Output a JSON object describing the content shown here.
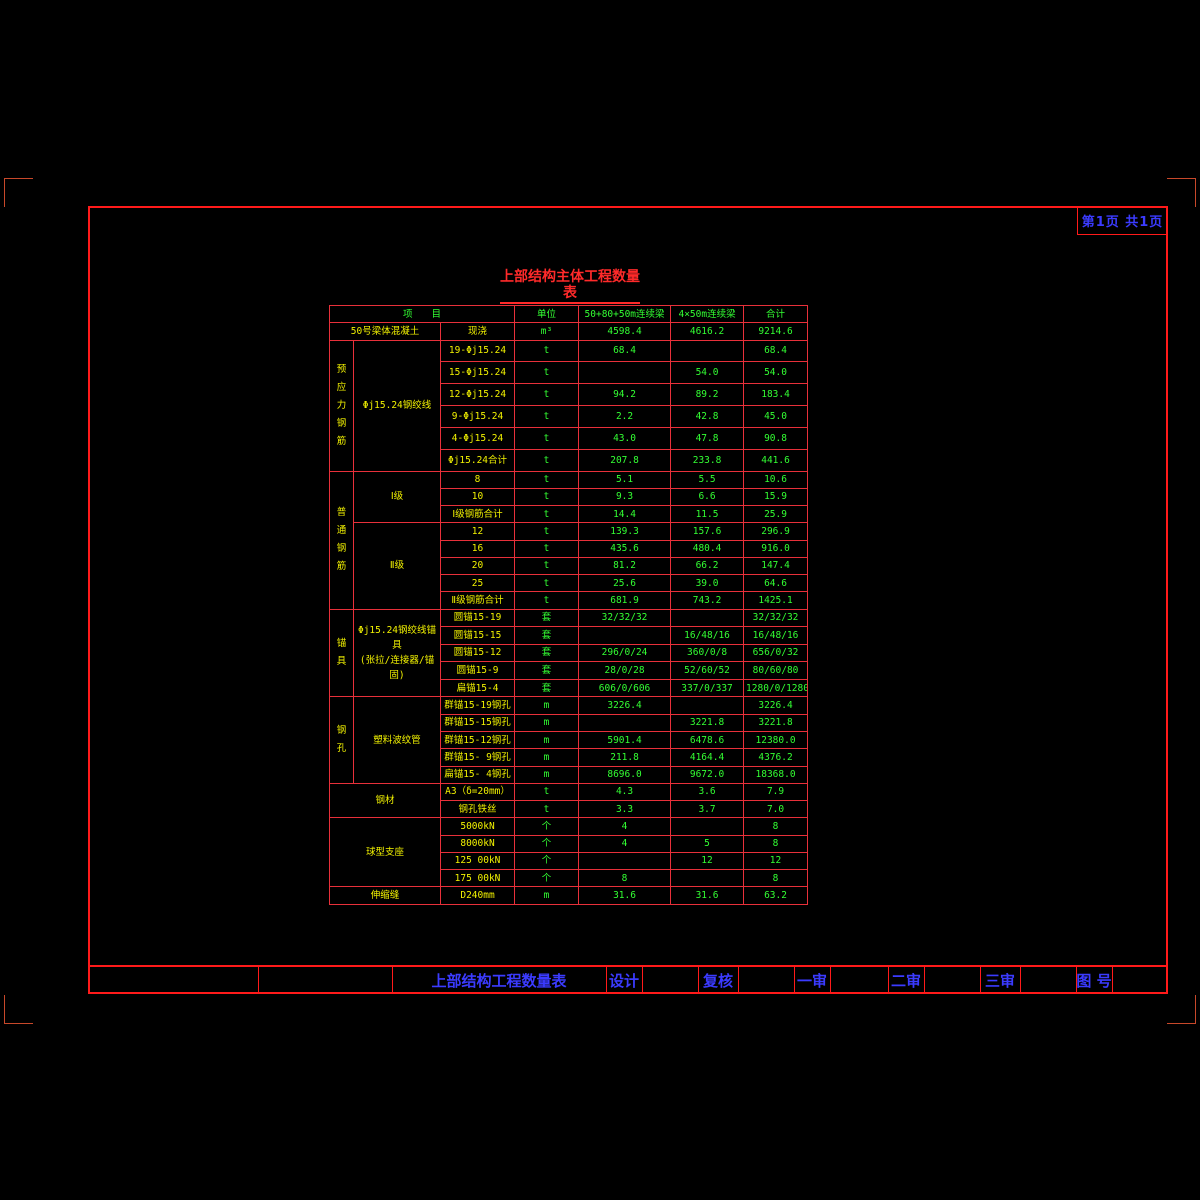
{
  "page_label": "第1页 共1页",
  "title": "上部结构主体工程数量表",
  "table": {
    "header": [
      "项　　目",
      "单位",
      "50+80+50m连续梁",
      "4×50m连续梁",
      "合计"
    ],
    "concrete": {
      "item": "50号梁体混凝土",
      "spec": "现浇",
      "unit": "m³",
      "a": "4598.4",
      "b": "4616.2",
      "total": "9214.6"
    },
    "prestress": {
      "group": "预应力钢筋",
      "sub": "Φj15.24钢绞线",
      "rows": [
        {
          "spec": "19-Φj15.24",
          "unit": "t",
          "a": "68.4",
          "b": "",
          "total": "68.4"
        },
        {
          "spec": "15-Φj15.24",
          "unit": "t",
          "a": "",
          "b": "54.0",
          "total": "54.0"
        },
        {
          "spec": "12-Φj15.24",
          "unit": "t",
          "a": "94.2",
          "b": "89.2",
          "total": "183.4"
        },
        {
          "spec": "9-Φj15.24",
          "unit": "t",
          "a": "2.2",
          "b": "42.8",
          "total": "45.0"
        },
        {
          "spec": "4-Φj15.24",
          "unit": "t",
          "a": "43.0",
          "b": "47.8",
          "total": "90.8"
        },
        {
          "spec": "Φj15.24合计",
          "unit": "t",
          "a": "207.8",
          "b": "233.8",
          "total": "441.6"
        }
      ]
    },
    "rebar": {
      "group": "普通钢筋",
      "grade1": {
        "label": "Ⅰ级",
        "rows": [
          {
            "spec": "8",
            "unit": "t",
            "a": "5.1",
            "b": "5.5",
            "total": "10.6"
          },
          {
            "spec": "10",
            "unit": "t",
            "a": "9.3",
            "b": "6.6",
            "total": "15.9"
          },
          {
            "spec": "Ⅰ级钢筋合计",
            "unit": "t",
            "a": "14.4",
            "b": "11.5",
            "total": "25.9"
          }
        ]
      },
      "grade2": {
        "label": "Ⅱ级",
        "rows": [
          {
            "spec": "12",
            "unit": "t",
            "a": "139.3",
            "b": "157.6",
            "total": "296.9"
          },
          {
            "spec": "16",
            "unit": "t",
            "a": "435.6",
            "b": "480.4",
            "total": "916.0"
          },
          {
            "spec": "20",
            "unit": "t",
            "a": "81.2",
            "b": "66.2",
            "total": "147.4"
          },
          {
            "spec": "25",
            "unit": "t",
            "a": "25.6",
            "b": "39.0",
            "total": "64.6"
          },
          {
            "spec": "Ⅱ级钢筋合计",
            "unit": "t",
            "a": "681.9",
            "b": "743.2",
            "total": "1425.1"
          }
        ]
      }
    },
    "anchor": {
      "group": "锚具",
      "sub1": "Φj15.24钢绞线锚具",
      "sub2": "(张拉/连接器/锚固)",
      "rows": [
        {
          "spec": "圆锚15-19",
          "unit": "套",
          "a": "32/32/32",
          "b": "",
          "total": "32/32/32"
        },
        {
          "spec": "圆锚15-15",
          "unit": "套",
          "a": "",
          "b": "16/48/16",
          "total": "16/48/16"
        },
        {
          "spec": "圆锚15-12",
          "unit": "套",
          "a": "296/0/24",
          "b": "360/0/8",
          "total": "656/0/32"
        },
        {
          "spec": "圆锚15-9",
          "unit": "套",
          "a": "28/0/28",
          "b": "52/60/52",
          "total": "80/60/80"
        },
        {
          "spec": "扁锚15-4",
          "unit": "套",
          "a": "606/0/606",
          "b": "337/0/337",
          "total": "1280/0/1280"
        }
      ]
    },
    "duct": {
      "group": "钢孔",
      "sub": "塑料波纹管",
      "rows": [
        {
          "spec": "群锚15-19钢孔",
          "unit": "m",
          "a": "3226.4",
          "b": "",
          "total": "3226.4"
        },
        {
          "spec": "群锚15-15钢孔",
          "unit": "m",
          "a": "",
          "b": "3221.8",
          "total": "3221.8"
        },
        {
          "spec": "群锚15-12钢孔",
          "unit": "m",
          "a": "5901.4",
          "b": "6478.6",
          "total": "12380.0"
        },
        {
          "spec": "群锚15- 9钢孔",
          "unit": "m",
          "a": "211.8",
          "b": "4164.4",
          "total": "4376.2"
        },
        {
          "spec": "扁锚15- 4钢孔",
          "unit": "m",
          "a": "8696.0",
          "b": "9672.0",
          "total": "18368.0"
        }
      ]
    },
    "steel": {
      "group": "钢材",
      "rows": [
        {
          "spec": "A3（δ=20mm）",
          "unit": "t",
          "a": "4.3",
          "b": "3.6",
          "total": "7.9"
        },
        {
          "spec": "钢孔铁丝",
          "unit": "t",
          "a": "3.3",
          "b": "3.7",
          "total": "7.0"
        }
      ]
    },
    "bearing": {
      "group": "球型支座",
      "rows": [
        {
          "spec": "5000kN",
          "unit": "个",
          "a": "4",
          "b": "",
          "total": "8"
        },
        {
          "spec": "8000kN",
          "unit": "个",
          "a": "4",
          "b": "5",
          "total": "8"
        },
        {
          "spec": "125 00kN",
          "unit": "个",
          "a": "",
          "b": "12",
          "total": "12"
        },
        {
          "spec": "175 00kN",
          "unit": "个",
          "a": "8",
          "b": "",
          "total": "8"
        }
      ]
    },
    "expansion": {
      "item": "伸缩缝",
      "spec": "D240mm",
      "unit": "m",
      "a": "31.6",
      "b": "31.6",
      "total": "63.2"
    }
  },
  "titleblock": {
    "drawing_name": "上部结构工程数量表",
    "design": "设计",
    "review": "复核",
    "first_check": "一审",
    "second_check": "二审",
    "third_check": "三审",
    "drawing_no": "图 号"
  },
  "colors": {
    "frame": "#ff1a1a",
    "text_title": "#ff2a2a",
    "text_cells_yellow": "#f2f200",
    "text_cells_green": "#33ff33",
    "titleblock_text": "#3b3bff"
  }
}
